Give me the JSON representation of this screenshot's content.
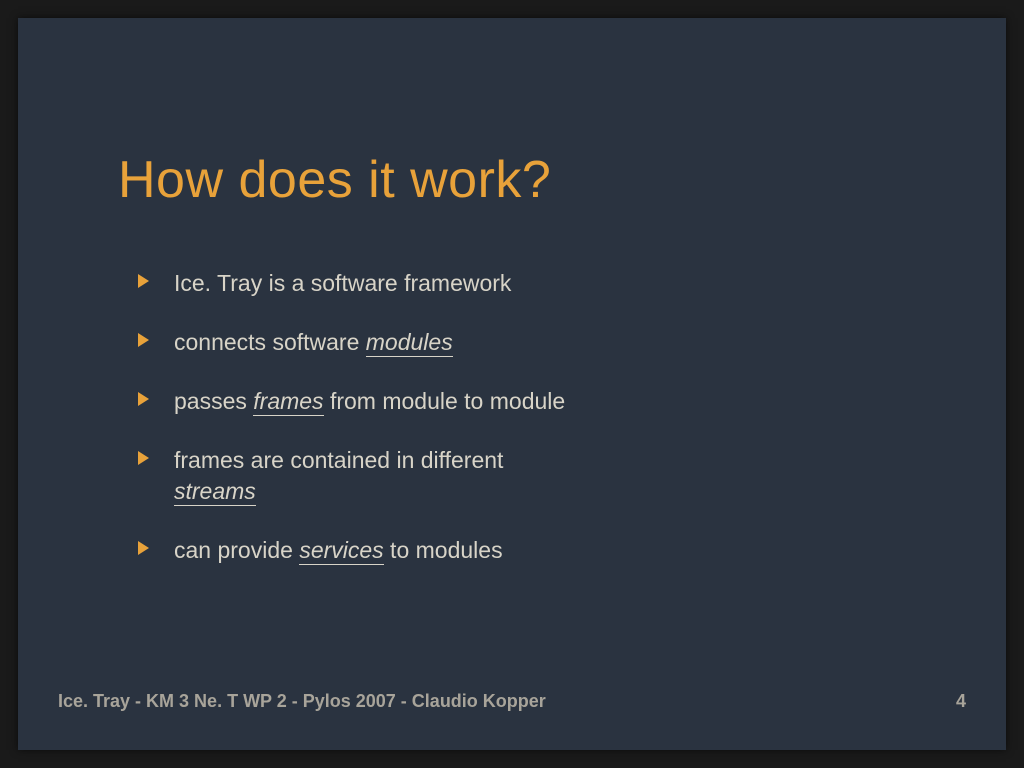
{
  "title": "How does it work?",
  "bullets": [
    {
      "plain0": "Ice. Tray is a software framework"
    },
    {
      "plain0": "connects software ",
      "em0": "modules"
    },
    {
      "plain0": "passes ",
      "em0": "frames",
      "plain1": " from module to module"
    },
    {
      "plain0": "frames are contained in different ",
      "em0": "streams"
    },
    {
      "plain0": "can provide ",
      "em0": "services",
      "plain1": " to modules"
    }
  ],
  "footer": {
    "text": "Ice. Tray - KM 3 Ne. T WP 2 - Pylos 2007 - Claudio Kopper",
    "page": "4"
  },
  "colors": {
    "accent": "#e8a23a",
    "bg": "#2a3340",
    "text": "#d8d4c8"
  }
}
